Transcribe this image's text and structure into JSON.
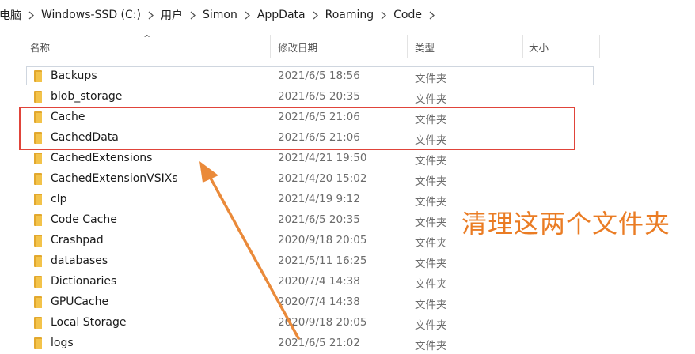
{
  "breadcrumb": {
    "items": [
      "电脑",
      "Windows-SSD (C:)",
      "用户",
      "Simon",
      "AppData",
      "Roaming",
      "Code"
    ]
  },
  "columns": {
    "name": "名称",
    "modified": "修改日期",
    "type": "类型",
    "size": "大小"
  },
  "sort_indicator": "^",
  "files": [
    {
      "name": "Backups",
      "modified": "2021/6/5 18:56",
      "type": "文件夹"
    },
    {
      "name": "blob_storage",
      "modified": "2021/6/5 20:35",
      "type": "文件夹"
    },
    {
      "name": "Cache",
      "modified": "2021/6/5 21:06",
      "type": "文件夹"
    },
    {
      "name": "CachedData",
      "modified": "2021/6/5 21:06",
      "type": "文件夹"
    },
    {
      "name": "CachedExtensions",
      "modified": "2021/4/21 19:50",
      "type": "文件夹"
    },
    {
      "name": "CachedExtensionVSIXs",
      "modified": "2021/4/20 15:02",
      "type": "文件夹"
    },
    {
      "name": "clp",
      "modified": "2021/4/19 9:12",
      "type": "文件夹"
    },
    {
      "name": "Code Cache",
      "modified": "2021/6/5 20:35",
      "type": "文件夹"
    },
    {
      "name": "Crashpad",
      "modified": "2020/9/18 20:05",
      "type": "文件夹"
    },
    {
      "name": "databases",
      "modified": "2021/5/11 16:25",
      "type": "文件夹"
    },
    {
      "name": "Dictionaries",
      "modified": "2020/7/4 14:38",
      "type": "文件夹"
    },
    {
      "name": "GPUCache",
      "modified": "2020/7/4 14:38",
      "type": "文件夹"
    },
    {
      "name": "Local Storage",
      "modified": "2020/9/18 20:05",
      "type": "文件夹"
    },
    {
      "name": "logs",
      "modified": "2021/6/5 21:02",
      "type": "文件夹"
    }
  ],
  "annotation": {
    "text": "清理这两个文件夹",
    "color": "#ea7c24",
    "highlight_color": "#e0443a"
  },
  "colors": {
    "folder": "#f3c34a",
    "folder_shade": "#e2a82e"
  }
}
